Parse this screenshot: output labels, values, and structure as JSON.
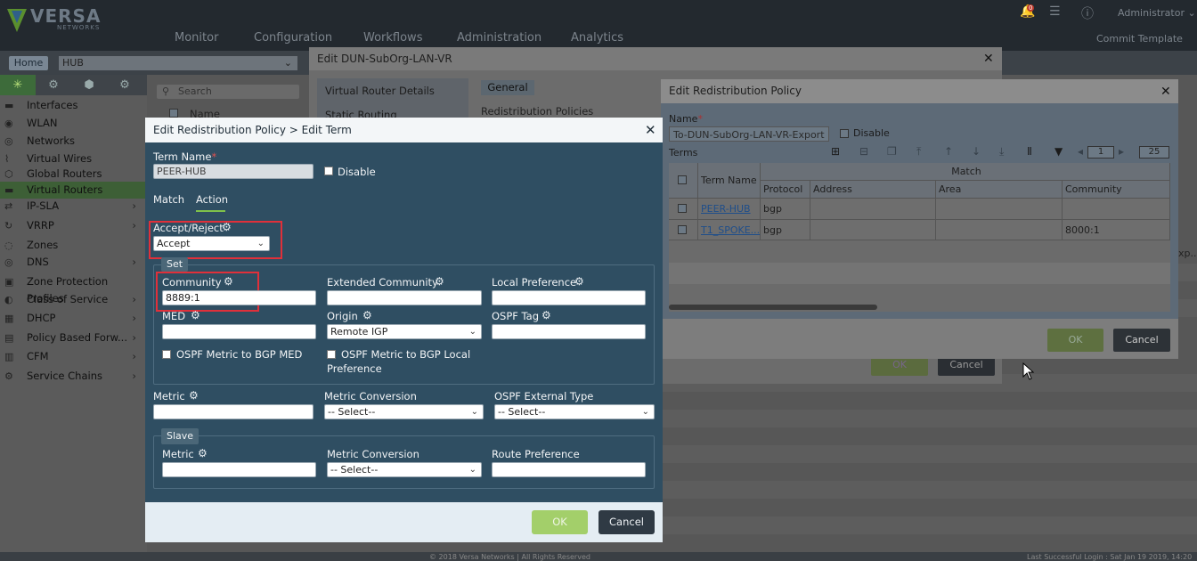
{
  "topbar": {
    "brand": "VERSA",
    "brand_sub": "NETWORKS",
    "nav": [
      "Monitor",
      "Configuration",
      "Workflows",
      "Administration",
      "Analytics"
    ],
    "notification_count": "0",
    "user": "Administrator",
    "commit_template": "Commit Template"
  },
  "bar2": {
    "home": "Home",
    "appliance": "HUB"
  },
  "sidebar": {
    "search_placeholder": "Search",
    "items": [
      {
        "label": "Interfaces",
        "icon": "interfaces-icon",
        "arrow": false
      },
      {
        "label": "WLAN",
        "icon": "wlan-icon",
        "arrow": false
      },
      {
        "label": "Networks",
        "icon": "networks-icon",
        "arrow": false
      },
      {
        "label": "Virtual Wires",
        "icon": "virtual-wires-icon",
        "arrow": false
      },
      {
        "label": "Global Routers",
        "icon": "global-routers-icon",
        "arrow": false
      },
      {
        "label": "Virtual Routers",
        "icon": "virtual-routers-icon",
        "arrow": false,
        "selected": true
      },
      {
        "label": "IP-SLA",
        "icon": "ip-sla-icon",
        "arrow": true
      },
      {
        "label": "VRRP",
        "icon": "vrrp-icon",
        "arrow": true
      },
      {
        "label": "Zones",
        "icon": "zones-icon",
        "arrow": false
      },
      {
        "label": "DNS",
        "icon": "dns-icon",
        "arrow": true
      },
      {
        "label": "Zone Protection Profiles",
        "icon": "zone-protection-icon",
        "arrow": false
      },
      {
        "label": "Class of Service",
        "icon": "class-of-service-icon",
        "arrow": true
      },
      {
        "label": "DHCP",
        "icon": "dhcp-icon",
        "arrow": true
      },
      {
        "label": "Policy Based Forw...",
        "icon": "pbf-icon",
        "arrow": true
      },
      {
        "label": "CFM",
        "icon": "cfm-icon",
        "arrow": true
      },
      {
        "label": "Service Chains",
        "icon": "service-chains-icon",
        "arrow": true
      }
    ],
    "list_header": "Name"
  },
  "dun_dialog": {
    "title": "Edit DUN-SubOrg-LAN-VR",
    "side_items": [
      "Virtual Router Details",
      "Static Routing"
    ],
    "tab": "General",
    "section": "Redistribution Policies",
    "ok": "OK",
    "cancel": "Cancel",
    "bg_text": "xp..."
  },
  "erp_dialog": {
    "title": "Edit Redistribution Policy",
    "name_label": "Name",
    "name_value": "To-DUN-SubOrg-LAN-VR-Export",
    "disable_label": "Disable",
    "terms_label": "Terms",
    "page_current": "1",
    "page_size": "25",
    "grid": {
      "col_term": "Term Name",
      "col_match": "Match",
      "sub_cols": [
        "Protocol",
        "Address",
        "Area",
        "Community"
      ],
      "rows": [
        {
          "term": "PEER-HUB",
          "protocol": "bgp",
          "address": "",
          "area": "",
          "community": ""
        },
        {
          "term": "T1_SPOKE...",
          "protocol": "bgp",
          "address": "",
          "area": "",
          "community": "8000:1"
        }
      ]
    },
    "ok": "OK",
    "cancel": "Cancel"
  },
  "term_dialog": {
    "title": "Edit Redistribution Policy > Edit Term",
    "term_name_label": "Term Name",
    "term_name_value": "PEER-HUB",
    "disable_label": "Disable",
    "tabs": [
      "Match",
      "Action"
    ],
    "accept_reject_label": "Accept/Reject",
    "accept_reject_value": "Accept",
    "set_legend": "Set",
    "community_label": "Community",
    "community_value": "8889:1",
    "ext_community_label": "Extended Community",
    "local_pref_label": "Local Preference",
    "med_label": "MED",
    "origin_label": "Origin",
    "origin_value": "Remote IGP",
    "ospf_tag_label": "OSPF Tag",
    "ospf_metric_med_label": "OSPF Metric to BGP MED",
    "ospf_metric_local_label_1": "OSPF Metric to BGP Local",
    "ospf_metric_local_label_2": "Preference",
    "metric_label": "Metric",
    "metric_conversion_label": "Metric Conversion",
    "metric_conversion_value": "-- Select--",
    "ospf_ext_type_label": "OSPF External Type",
    "ospf_ext_type_value": "-- Select--",
    "slave_legend": "Slave",
    "slave_metric_label": "Metric",
    "slave_metric_conv_label": "Metric Conversion",
    "slave_metric_conv_value": "-- Select--",
    "route_pref_label": "Route Preference",
    "ok": "OK",
    "cancel": "Cancel"
  },
  "status": {
    "copyright": "© 2018 Versa Networks | All Rights Reserved",
    "last_login": "Last Successful Login : Sat Jan 19 2019, 14:20"
  }
}
